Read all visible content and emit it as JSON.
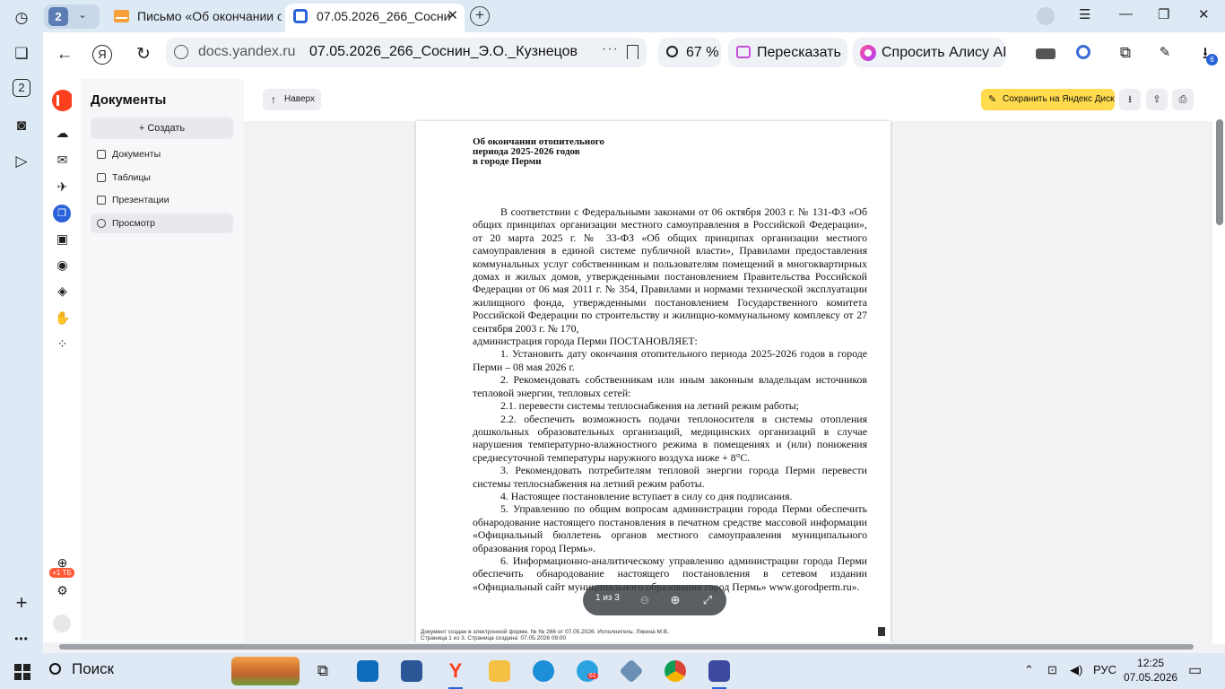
{
  "browser": {
    "tab_count": "2",
    "tabs": [
      {
        "title": "Письмо «Об окончании о"
      },
      {
        "title": "07.05.2026_266_Сосни"
      }
    ],
    "url_domain": "docs.yandex.ru",
    "url_title": "07.05.2026_266_Соснин_Э.О._Кузнецов...",
    "zoom": "67 %",
    "retell_label": "Пересказать",
    "alice_label": "Спросить Алису AI",
    "downloads_badge": "6",
    "accent_color": "#2a63d9"
  },
  "sidebar": {
    "title": "Документы",
    "create_label": "+ Создать",
    "items": [
      {
        "label": "Документы"
      },
      {
        "label": "Таблицы"
      },
      {
        "label": "Презентации"
      },
      {
        "label": "Просмотр"
      }
    ],
    "storage_badge": "+1 ТБ"
  },
  "toolbar": {
    "up_label": "Наверх",
    "save_disk_label": "Сохранить на Яндекс Диск",
    "save_disk_color": "#ffdb4d"
  },
  "document": {
    "title_lines": [
      "Об окончании отопительного",
      "периода 2025-2026 годов",
      "в городе Перми"
    ],
    "paragraphs": [
      "В соответствии с Федеральными законами от 06 октября 2003 г. № 131-ФЗ «Об общих принципах организации местного самоуправления в Российской Федерации», от 20 марта 2025 г. № 33-ФЗ «Об общих принципах организации местного самоуправления в единой системе публичной власти», Правилами предоставления коммунальных услуг собственникам и пользователям помещений в многоквартирных домах и жилых домов, утвержденными постановлением Правительства Российской Федерации от 06 мая 2011 г. № 354, Правилами и нормами технической эксплуатации жилищного фонда, утвержденными постановлением Государственного комитета Российской Федерации по строительству и жилищно-коммунальному комплексу от 27 сентября 2003 г. № 170,",
      "администрация города Перми ПОСТАНОВЛЯЕТ:",
      "1. Установить дату окончания отопительного периода 2025-2026 годов в городе Перми – 08 мая 2026 г.",
      "2. Рекомендовать собственникам или иным законным владельцам источников тепловой энергии, тепловых сетей:",
      "2.1. перевести системы теплоснабжения на летний режим работы;",
      "2.2. обеспечить возможность подачи теплоносителя в системы отопления дошкольных образовательных организаций, медицинских организаций в случае нарушения температурно-влажностного режима в помещениях и (или) понижения среднесуточной температуры наружного воздуха ниже + 8°С.",
      "3. Рекомендовать потребителям тепловой энергии города Перми перевести системы теплоснабжения на летний режим работы.",
      "4. Настоящее постановление вступает в силу со дня подписания.",
      "5. Управлению по общим вопросам администрации города Перми обеспечить обнародование настоящего постановления в печатном средстве массовой информации «Официальный бюллетень органов местного самоуправления муниципального образования город Пермь».",
      "6. Информационно-аналитическому управлению администрации города Перми обеспечить обнародование настоящего постановления в сетевом издании «Официальный сайт муниципального образования город Пермь» www.gorodperm.ru»."
    ],
    "footer_line1": "Документ создан в электронной форме. № № 266 от 07.05.2026. Исполнитель: Лякина М.В.",
    "footer_line2": "Страница 1 из 3. Страница создана: 07.05.2026 09:00"
  },
  "pager": {
    "page_indicator": "1 из 3"
  },
  "taskbar": {
    "search_label": "Поиск",
    "language": "РУС",
    "time": "12:25",
    "date": "07.05.2026",
    "telegram_badge": "61"
  }
}
